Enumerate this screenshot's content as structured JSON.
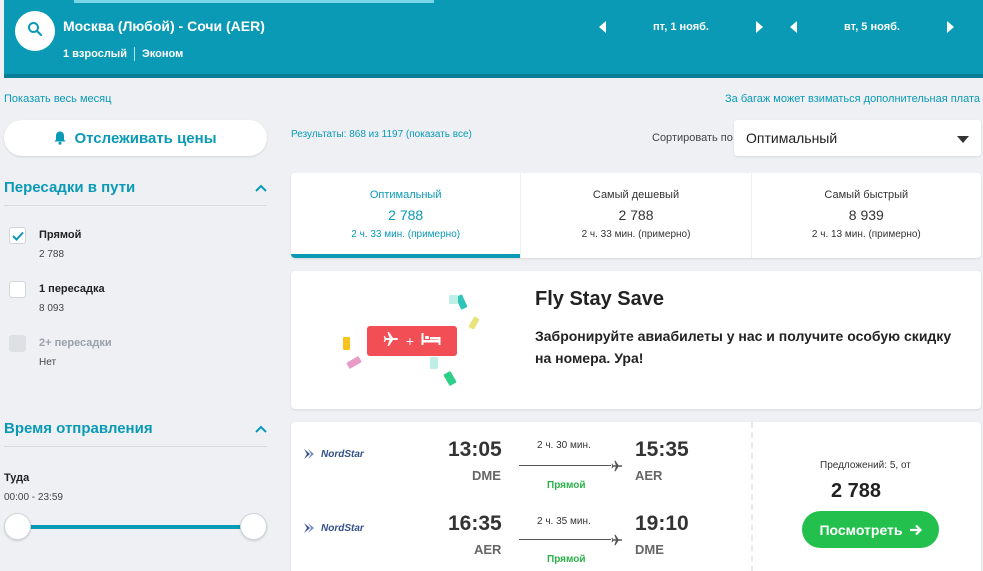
{
  "header": {
    "route": "Москва (Любой) - Сочи (AER)",
    "passengers": "1 взрослый",
    "cabin": "Эконом",
    "depart_date": "пт, 1 нояб.",
    "return_date": "вт, 5 нояб."
  },
  "links": {
    "show_month": "Показать весь месяц",
    "baggage_note": "За багаж может взиматься дополнительная плата"
  },
  "track_prices": "Отслеживать цены",
  "filters": {
    "stops_title": "Пересадки в пути",
    "options": [
      {
        "label": "Прямой",
        "price": "2 788 ",
        "checked": true,
        "disabled": false
      },
      {
        "label": "1 пересадка",
        "price": "8 093 ",
        "checked": false,
        "disabled": false
      },
      {
        "label": "2+ пересадки",
        "price": "Нет",
        "checked": false,
        "disabled": true
      }
    ],
    "time_title": "Время отправления",
    "direction": "Туда",
    "time_range": "00:00 - 23:59"
  },
  "results": {
    "count": "Результаты: 868 из 1197 (показать все)",
    "sort_label": "Сортировать по",
    "sort_value": "Оптимальный"
  },
  "tabs": [
    {
      "title": "Оптимальный",
      "price": "2 788 ",
      "duration": "2 ч. 33 мин. (примерно)",
      "active": true
    },
    {
      "title": "Самый дешевый",
      "price": "2 788 ",
      "duration": "2 ч. 33 мин. (примерно)",
      "active": false
    },
    {
      "title": "Самый быстрый",
      "price": "8 939 ",
      "duration": "2 ч. 13 мин. (примерно)",
      "active": false
    }
  ],
  "promo": {
    "title": "Fly Stay Save",
    "text": "Забронируйте авиабилеты у нас и получите особую скидку на номера. Ура!",
    "badge_plus": "+"
  },
  "flight": {
    "legs": [
      {
        "airline": "NordStar",
        "dep_time": "13:05",
        "dep_airport": "DME",
        "duration": "2 ч. 30 мин.",
        "stops": "Прямой",
        "arr_time": "15:35",
        "arr_airport": "AER"
      },
      {
        "airline": "NordStar",
        "dep_time": "16:35",
        "dep_airport": "AER",
        "duration": "2 ч. 35 мин.",
        "stops": "Прямой",
        "arr_time": "19:10",
        "arr_airport": "DME"
      }
    ],
    "offers": "Предложений: 5, от",
    "price": "2 788 ",
    "view_button": "Посмотреть"
  },
  "colors": {
    "brand": "#0a9ab6",
    "green": "#23c04d",
    "promo_red": "#f24e56"
  }
}
